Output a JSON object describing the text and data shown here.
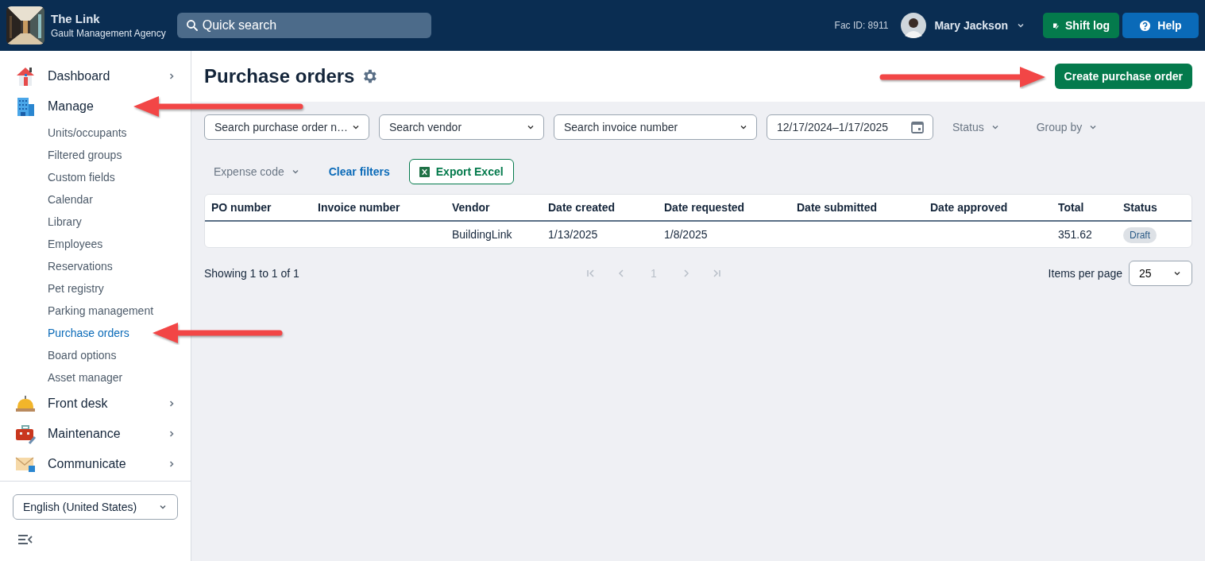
{
  "topbar": {
    "title": "The Link",
    "subtitle": "Gault Management Agency",
    "search": {
      "placeholder": "Quick search"
    },
    "facility": "Fac ID: 8911",
    "user": "Mary Jackson",
    "buttons": [
      {
        "kind": "shift",
        "label": "Shift log"
      },
      {
        "kind": "help",
        "label": "Help"
      }
    ]
  },
  "sidebar": {
    "items": [
      {
        "label": "Dashboard",
        "expanded": false,
        "pointed": false
      },
      {
        "label": "Manage",
        "expanded": true,
        "pointed": true,
        "children": [
          {
            "label": "Units/occupants",
            "selected": false,
            "pointed": false
          },
          {
            "label": "Filtered groups",
            "selected": false,
            "pointed": false
          },
          {
            "label": "Custom fields",
            "selected": false,
            "pointed": false
          },
          {
            "label": "Calendar",
            "selected": false,
            "pointed": false
          },
          {
            "label": "Library",
            "selected": false,
            "pointed": false
          },
          {
            "label": "Employees",
            "selected": false,
            "pointed": false
          },
          {
            "label": "Reservations",
            "selected": false,
            "pointed": false
          },
          {
            "label": "Pet registry",
            "selected": false,
            "pointed": false
          },
          {
            "label": "Parking management",
            "selected": false,
            "pointed": false
          },
          {
            "label": "Purchase orders",
            "selected": true,
            "pointed": true
          },
          {
            "label": "Board options",
            "selected": false,
            "pointed": false
          },
          {
            "label": "Asset manager",
            "selected": false,
            "pointed": false
          }
        ]
      },
      {
        "label": "Front desk",
        "expanded": false,
        "pointed": false
      },
      {
        "label": "Maintenance",
        "expanded": false,
        "pointed": false
      },
      {
        "label": "Communicate",
        "expanded": false,
        "pointed": false
      }
    ],
    "language": "English (United States)"
  },
  "page": {
    "title": "Purchase orders",
    "create_button": {
      "label": "Create purchase order",
      "pointed": true
    },
    "filters": [
      {
        "kind": "select",
        "label": "Search purchase order n…"
      },
      {
        "kind": "select",
        "label": "Search vendor"
      },
      {
        "kind": "select",
        "label": "Search invoice number"
      },
      {
        "kind": "date",
        "label": "12/17/2024–1/17/2025"
      },
      {
        "kind": "menu",
        "label": "Status"
      },
      {
        "kind": "menu",
        "label": "Group by"
      },
      {
        "kind": "menu",
        "label": "Expense code"
      },
      {
        "kind": "link",
        "label": "Clear filters"
      },
      {
        "kind": "export",
        "label": "Export Excel"
      }
    ],
    "table": {
      "columns": [
        "PO number",
        "Invoice number",
        "Vendor",
        "Date created",
        "Date requested",
        "Date submitted",
        "Date approved",
        "Total",
        "Status"
      ],
      "rows": [
        {
          "cells": [
            "",
            "",
            "BuildingLink",
            "1/13/2025",
            "1/8/2025",
            "",
            "",
            "351.62"
          ],
          "status": "Draft"
        }
      ]
    },
    "pagination": {
      "summary": "Showing 1 to 1 of 1",
      "page": "1",
      "items_per_page_label": "Items per page",
      "items_per_page": "25"
    }
  }
}
